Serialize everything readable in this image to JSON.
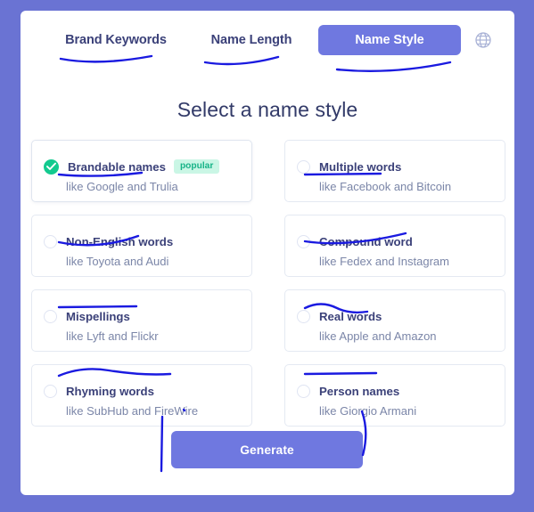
{
  "theme": {
    "page_background": "#6a73d3",
    "card_background": "#ffffff",
    "accent": "#6f78e0",
    "success": "#13ca8f",
    "badge_background": "#caf6e5",
    "badge_text": "#16b387",
    "heading_text": "#323a68",
    "label_text": "#3b4179",
    "description_text": "#7b86a8",
    "annotation_ink": "#1a1ae0"
  },
  "tabs": [
    {
      "label": "Brand Keywords",
      "active": false
    },
    {
      "label": "Name Length",
      "active": false
    },
    {
      "label": "Name Style",
      "active": true
    }
  ],
  "language_icon": "globe-icon",
  "heading": "Select a name style",
  "options": [
    {
      "label": "Brandable names",
      "description": "like Google and Trulia",
      "selected": true,
      "badge": "popular"
    },
    {
      "label": "Multiple words",
      "description": "like Facebook and Bitcoin",
      "selected": false,
      "badge": ""
    },
    {
      "label": "Non-English words",
      "description": "like Toyota and Audi",
      "selected": false,
      "badge": ""
    },
    {
      "label": "Compound word",
      "description": "like Fedex and Instagram",
      "selected": false,
      "badge": ""
    },
    {
      "label": "Mispellings",
      "description": "like Lyft and Flickr",
      "selected": false,
      "badge": ""
    },
    {
      "label": "Real words",
      "description": "like Apple and Amazon",
      "selected": false,
      "badge": ""
    },
    {
      "label": "Rhyming words",
      "description": "like SubHub and FireWire",
      "selected": false,
      "badge": ""
    },
    {
      "label": "Person names",
      "description": "like Giorgio Armani",
      "selected": false,
      "badge": ""
    }
  ],
  "generate_button": "Generate"
}
